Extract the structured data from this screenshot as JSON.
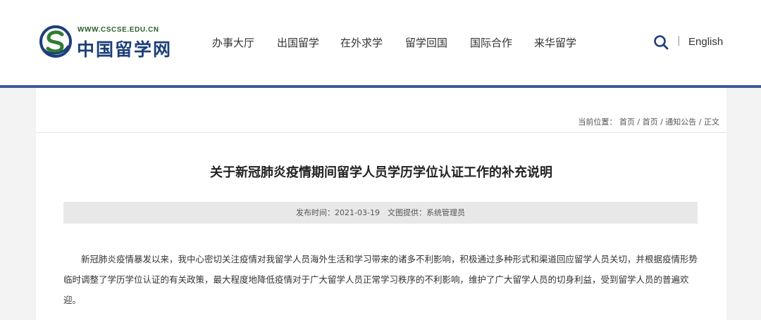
{
  "header": {
    "logo": {
      "domain": "WWW.CSCSE.EDU.CN",
      "name": "中国留学网"
    },
    "nav": [
      "办事大厅",
      "出国留学",
      "在外求学",
      "留学回国",
      "国际合作",
      "来华留学"
    ],
    "search_icon": "search-icon",
    "separator": "|",
    "language_link": "English",
    "accent_color": "#3d5a9a"
  },
  "breadcrumb": "当前位置： 首页 / 首页 / 通知公告 / 正文",
  "article": {
    "title": "关于新冠肺炎疫情期间留学人员学历学位认证工作的补充说明",
    "meta": "发布时间：2021-03-19　文图提供：系统管理员",
    "paragraph": "新冠肺炎疫情暴发以来，我中心密切关注疫情对我留学人员海外生活和学习带来的诸多不利影响，积极通过多种形式和渠道回应留学人员关切，并根据疫情形势临时调整了学历学位认证的有关政策，最大程度地降低疫情对于广大留学人员正常学习秩序的不利影响，维护了广大留学人员的切身利益，受到留学人员的普遍欢迎。"
  }
}
